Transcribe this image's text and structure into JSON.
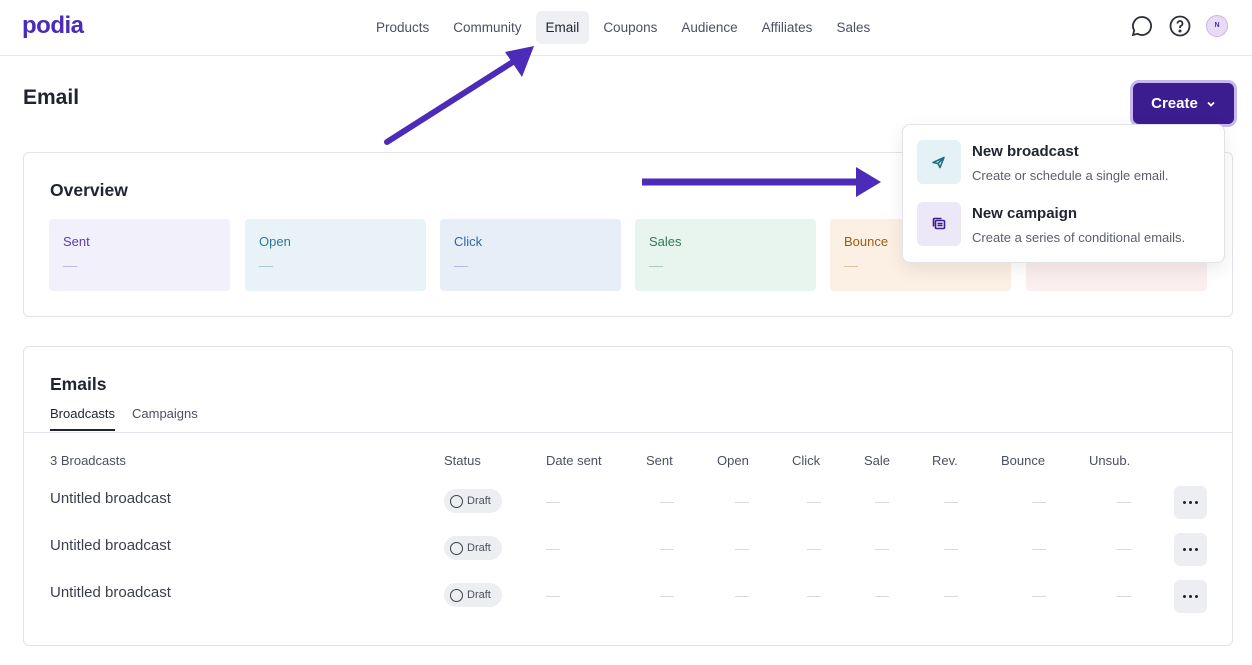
{
  "app": {
    "logo": "podia"
  },
  "nav": {
    "items": [
      {
        "label": "Products"
      },
      {
        "label": "Community"
      },
      {
        "label": "Email"
      },
      {
        "label": "Coupons"
      },
      {
        "label": "Audience"
      },
      {
        "label": "Affiliates"
      },
      {
        "label": "Sales"
      }
    ],
    "active_item": "Email",
    "avatar_initial": "N"
  },
  "page": {
    "title": "Email"
  },
  "create_button": {
    "label": "Create"
  },
  "create_menu": {
    "items": [
      {
        "title": "New broadcast",
        "description": "Create or schedule a single email.",
        "icon": "send-icon"
      },
      {
        "title": "New campaign",
        "description": "Create a series of conditional emails.",
        "icon": "stack-icon"
      }
    ]
  },
  "overview": {
    "title": "Overview",
    "stats": [
      {
        "label": "Sent",
        "value": "—",
        "bg": "#f2f0fa",
        "color": "#5b3db0"
      },
      {
        "label": "Open",
        "value": "—",
        "bg": "#e9f3f7",
        "color": "#2c7a99"
      },
      {
        "label": "Click",
        "value": "—",
        "bg": "#e7eef8",
        "color": "#3464a8"
      },
      {
        "label": "Sales",
        "value": "—",
        "bg": "#e8f4ee",
        "color": "#2f7a55"
      },
      {
        "label": "Bounce",
        "value": "—",
        "bg": "#fbf0e3",
        "color": "#9a5c12"
      },
      {
        "label": "",
        "value": "—",
        "bg": "#fbeeee",
        "color": "#a83a3a"
      }
    ]
  },
  "emails": {
    "title": "Emails",
    "tabs": [
      {
        "label": "Broadcasts"
      },
      {
        "label": "Campaigns"
      }
    ],
    "active_tab": "Broadcasts",
    "columns": [
      "3 Broadcasts",
      "Status",
      "Date sent",
      "Sent",
      "Open",
      "Click",
      "Sale",
      "Rev.",
      "Bounce",
      "Unsub."
    ],
    "rows": [
      {
        "name": "Untitled broadcast",
        "status": "Draft"
      },
      {
        "name": "Untitled broadcast",
        "status": "Draft"
      },
      {
        "name": "Untitled broadcast",
        "status": "Draft"
      }
    ]
  },
  "colors": {
    "brand": "#4b2bb8",
    "create_button": "#3b1d8f",
    "annotation_arrow": "#4b2bb8"
  }
}
